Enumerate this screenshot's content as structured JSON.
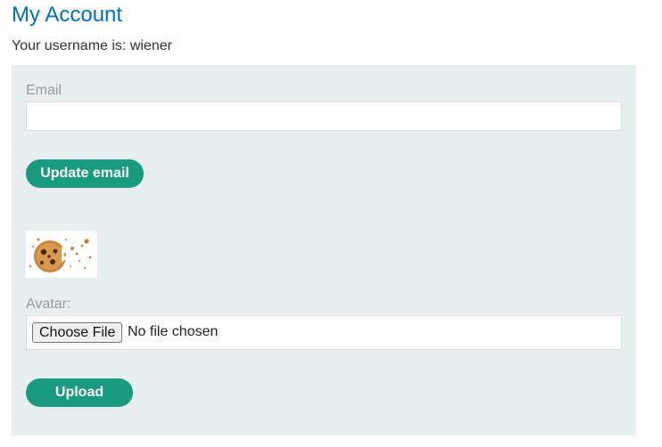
{
  "page": {
    "title": "My Account",
    "username_line": "Your username is: wiener"
  },
  "email_form": {
    "label": "Email",
    "value": "",
    "placeholder": "",
    "submit_label": "Update email"
  },
  "avatar_form": {
    "image_name": "cookie-avatar-image",
    "label": "Avatar:",
    "choose_file_label": "Choose File",
    "file_status": "No file chosen",
    "submit_label": "Upload"
  },
  "colors": {
    "title": "#0071bc",
    "button": "#1a9b7f",
    "panel": "#e8eef0",
    "label": "#999999"
  }
}
